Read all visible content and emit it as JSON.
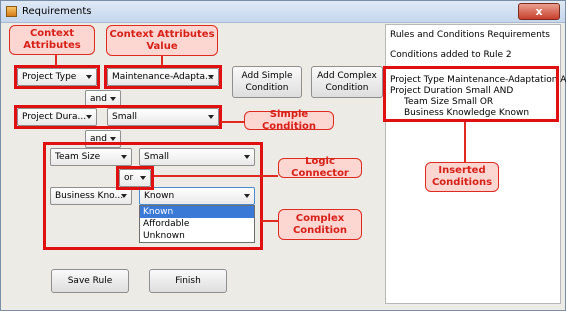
{
  "window": {
    "title": "Requirements",
    "close_glyph": "x"
  },
  "annotations": {
    "context_attributes": "Context Attributes",
    "context_attributes_value": "Context Attributes Value",
    "simple_condition": "Simple Condition",
    "logic_connector": "Logic Connector",
    "complex_condition": "Complex Condition",
    "inserted_conditions": "Inserted Conditions"
  },
  "row1": {
    "attribute": "Project Type",
    "value": "Maintenance-Adapta..."
  },
  "row2": {
    "attribute": "Project Dura...",
    "value": "Small"
  },
  "connector1": "and",
  "connector2": "and",
  "complex": {
    "attr1": "Team Size",
    "value1": "Small",
    "connector": "or",
    "attr2": "Business Kno...",
    "value2": "Known",
    "dropdown_options": [
      "Known",
      "Affordable",
      "Unknown"
    ]
  },
  "buttons": {
    "add_simple": [
      "Add Simple",
      "Condition"
    ],
    "add_complex": [
      "Add Complex",
      "Condition"
    ],
    "save": "Save Rule",
    "finish": "Finish"
  },
  "rules_panel": {
    "header": "Rules and Conditions Requirements",
    "subheader": "Conditions added to Rule 2",
    "lines": [
      "Project Type Maintenance-Adaptation  AND",
      "Project Duration Small  AND",
      "Team Size Small  OR",
      "Business Knowledge Known"
    ]
  },
  "colors": {
    "annotation_red": "#e01010",
    "callout_fill": "#fcd6d0",
    "selection_blue": "#3a79d6"
  }
}
